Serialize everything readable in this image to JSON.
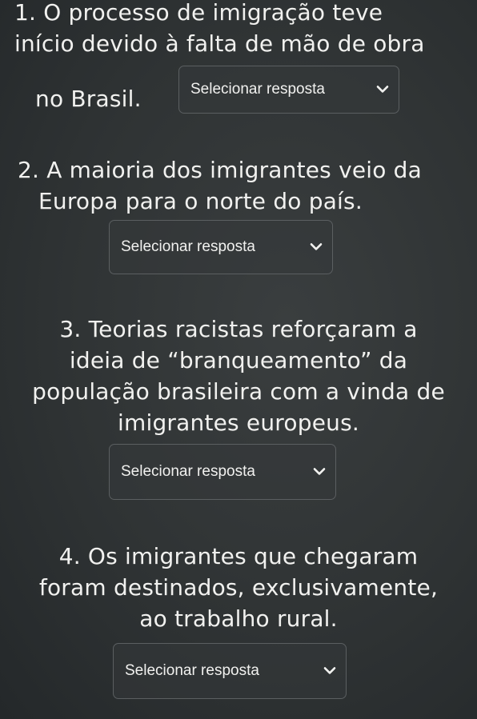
{
  "questions": [
    {
      "lines": [
        "1. O processo de imigração teve",
        "início devido à falta de mão de obra",
        "no Brasil."
      ],
      "select_label": "Selecionar resposta"
    },
    {
      "lines": [
        "2. A maioria dos imigrantes veio da",
        "Europa para o norte do país."
      ],
      "select_label": "Selecionar resposta"
    },
    {
      "lines": [
        "3. Teorias racistas reforçaram a",
        "ideia de “branqueamento” da",
        "população brasileira com a vinda de",
        "imigrantes europeus."
      ],
      "select_label": "Selecionar resposta"
    },
    {
      "lines": [
        "4. Os imigrantes que chegaram",
        "foram destinados, exclusivamente,",
        "ao trabalho rural."
      ],
      "select_label": "Selecionar resposta"
    }
  ],
  "icons": {
    "dropdown": "chevron-down-icon"
  },
  "colors": {
    "background": "#2f3334",
    "text": "#f1f1ef",
    "select_border": "#5b5f61"
  }
}
